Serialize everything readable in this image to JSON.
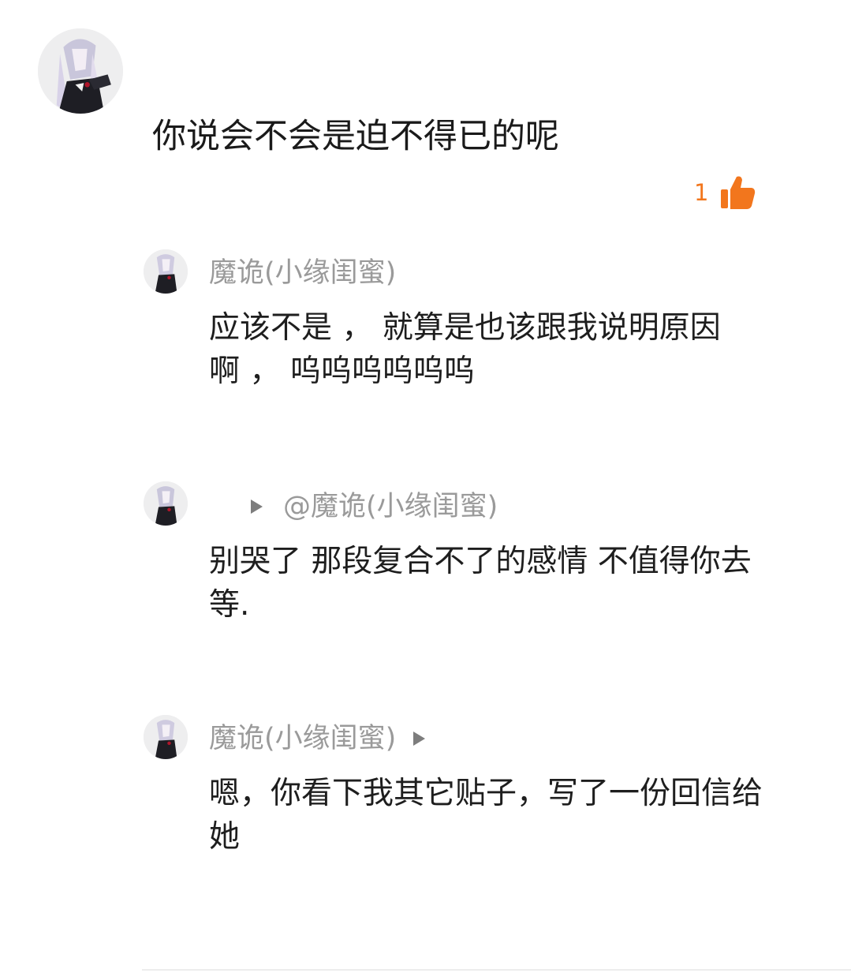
{
  "main_comment": {
    "text": "你说会不会是迫不得已的呢",
    "like_count": "1",
    "like_icon": "thumbs-up-icon",
    "like_color": "#f2761d"
  },
  "replies": [
    {
      "author": "魔诡(小缘闺蜜)",
      "text_line1": "应该不是 ， 就算是也该跟我说明原因",
      "text_line2": "啊 ， 呜呜呜呜呜呜"
    },
    {
      "reply_to": "@魔诡(小缘闺蜜)",
      "text_line1": "别哭了 那段复合不了的感情  不值得你去",
      "text_line2": "等."
    },
    {
      "author": "魔诡(小缘闺蜜)",
      "text_line1": "嗯，你看下我其它贴子，写了一份回信给",
      "text_line2": "她"
    }
  ],
  "colors": {
    "muted_text": "#9a9a9a",
    "body_text": "#1e1e1e",
    "accent": "#f2761d"
  }
}
